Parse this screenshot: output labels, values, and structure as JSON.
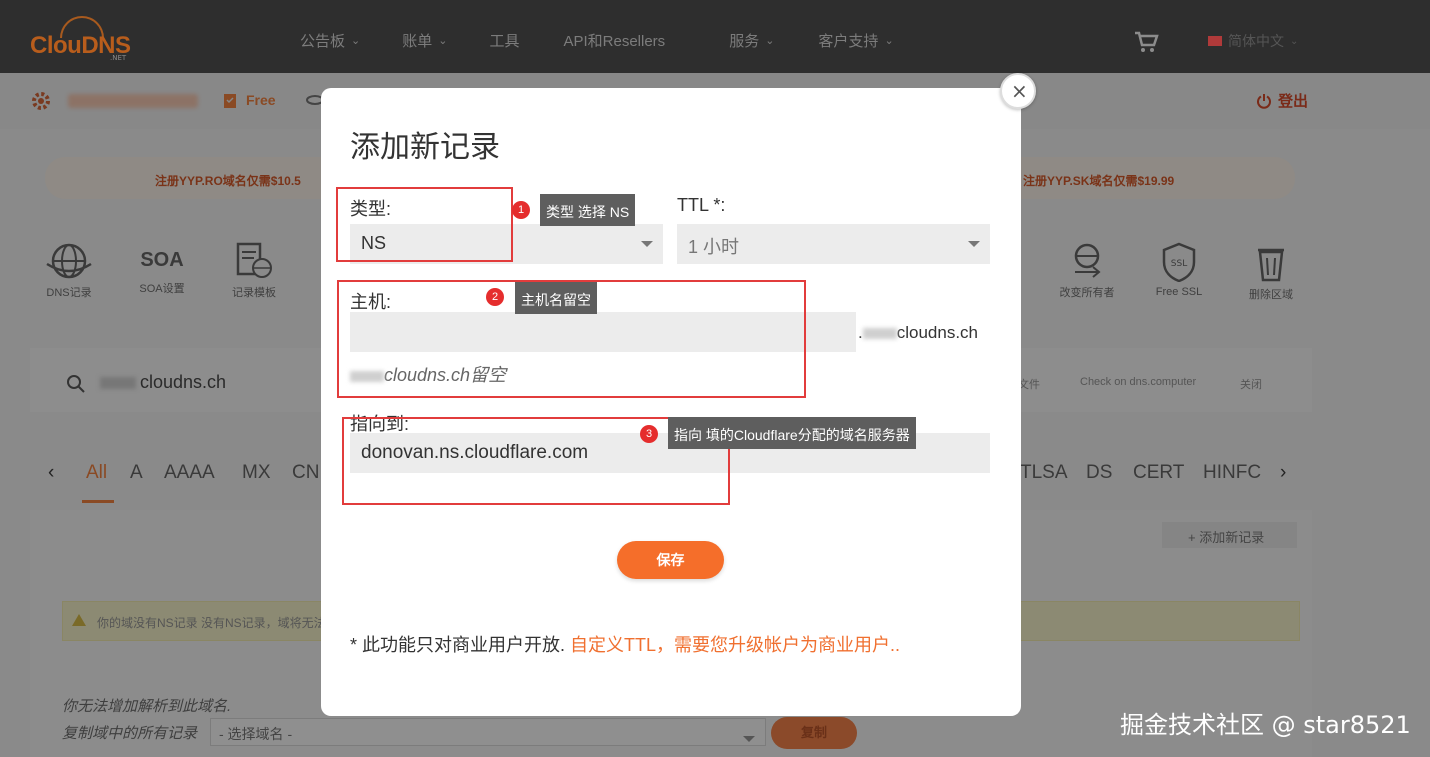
{
  "header": {
    "logo_text": "ClouDNS",
    "logo_sub": ".NET",
    "nav": [
      "公告板",
      "账单",
      "工具",
      "API和Resellers",
      "服务",
      "客户支持"
    ],
    "nav_dropdowns": [
      true,
      true,
      false,
      false,
      true,
      true
    ],
    "language": "简体中文"
  },
  "subbar": {
    "plan": "Free",
    "logout": "登出"
  },
  "promo": {
    "left": "注册YYP.RO域名仅需$10.5",
    "right": "注册YYP.SK域名仅需$19.99"
  },
  "tools": {
    "dns_records": "DNS记录",
    "soa_text": "SOA",
    "soa_settings": "SOA设置",
    "templates": "记录模板",
    "change_owner": "改变所有者",
    "free_ssl": "Free SSL",
    "ssl_text": "SSL",
    "delete_zone": "删除区域"
  },
  "zone": {
    "domain_suffix": "cloudns.ch",
    "file_label": "文件",
    "check_label": "Check on dns.computer",
    "close_label": "关闭"
  },
  "record_tabs": {
    "left": [
      "All",
      "A",
      "AAAA",
      "MX",
      "CN"
    ],
    "right": [
      "TLSA",
      "DS",
      "CERT",
      "HINFC"
    ]
  },
  "content": {
    "add_record": "+ 添加新记录",
    "warning": "你的域没有NS记录 没有NS记录，域将无法",
    "cant_add": "你无法增加解析到此域名.",
    "copy_label": "复制域中的所有记录",
    "select_placeholder": "- 选择域名 -",
    "copy_button": "复制"
  },
  "modal": {
    "title": "添加新记录",
    "close_symbol": "×",
    "type_label": "类型:",
    "type_value": "NS",
    "ttl_label": "TTL *:",
    "ttl_value": "1 小时",
    "host_label": "主机:",
    "host_value": "",
    "host_suffix_dot": ".",
    "host_suffix": "cloudns.ch",
    "host_hint": "cloudns.ch留空",
    "points_to_label": "指向到:",
    "points_to_value": "donovan.ns.cloudflare.com",
    "save_button": "保存",
    "note_prefix": "* 此功能只对商业用户开放.",
    "note_link": "自定义TTL，需要您升级帐户为商业用户.."
  },
  "annotations": [
    {
      "number": "1",
      "text": "类型 选择 NS"
    },
    {
      "number": "2",
      "text": "主机名留空"
    },
    {
      "number": "3",
      "text": "指向 填的Cloudflare分配的域名服务器"
    }
  ],
  "watermark": "掘金技术社区 @ star8521",
  "colors": {
    "accent": "#f56e2a",
    "annotation_red": "#e23c3c",
    "overlay": "#8a8a8a"
  }
}
